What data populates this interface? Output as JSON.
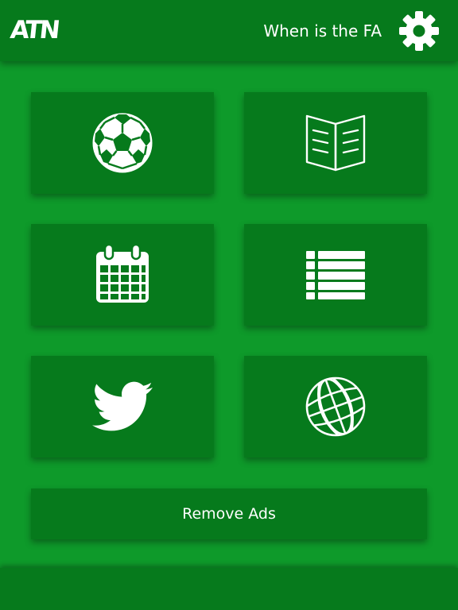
{
  "header": {
    "logo_text": "ATN",
    "title": "When is the FA",
    "settings_icon": "gear-icon"
  },
  "tiles": [
    {
      "icon": "soccer-ball-icon"
    },
    {
      "icon": "open-book-icon"
    },
    {
      "icon": "calendar-icon"
    },
    {
      "icon": "list-icon"
    },
    {
      "icon": "twitter-bird-icon"
    },
    {
      "icon": "globe-icon"
    }
  ],
  "remove_ads": {
    "label": "Remove Ads"
  },
  "colors": {
    "background": "#0e9a2a",
    "panel": "#067a1c",
    "foreground": "#ffffff"
  }
}
